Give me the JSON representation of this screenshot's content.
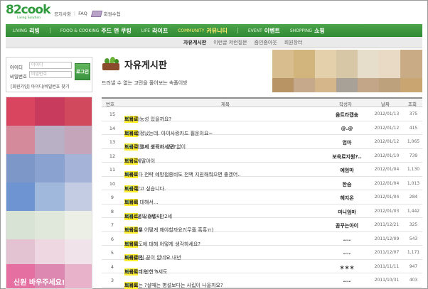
{
  "header": {
    "logo_text": "82cook",
    "logo_sub": "Living Solution",
    "links": [
      "공지사항",
      "FAQ",
      "회원수첩"
    ]
  },
  "nav": {
    "items": [
      {
        "en": "LIVING",
        "ko": "리빙",
        "active": false
      },
      {
        "en": "FOOD & COOKING",
        "ko": "주드 앤 쿠킹",
        "active": false
      },
      {
        "en": "LIFE",
        "ko": "라이프",
        "active": false
      },
      {
        "en": "COMMUNITY",
        "ko": "커뮤니티",
        "active": true
      },
      {
        "en": "EVENT",
        "ko": "이벤트",
        "active": false
      },
      {
        "en": "SHOPPING",
        "ko": "쇼핑",
        "active": false
      }
    ]
  },
  "subnav": {
    "items": [
      "자유게시판",
      "이런글 저런질문",
      "줌인줌아웃",
      "회원장터"
    ]
  },
  "login": {
    "id_label": "아이디",
    "pw_label": "비밀번호",
    "id_placeholder": "아이디",
    "pw_placeholder": "비밀번호",
    "button": "로그인",
    "links": "[회원가입]  아이디/비밀번호 찾기"
  },
  "side_banner": {
    "caption": "신원 바우주세요!"
  },
  "board": {
    "title": "자유게시판",
    "description": "드러낼 수 없는 고민을 풀어보는 속풀이방",
    "columns": [
      "번호",
      "제목",
      "작성자",
      "날짜",
      "조회"
    ],
    "rows": [
      {
        "no": "15",
        "pre": "",
        "hl": "보육료",
        "post": "지원 가능성 있을까요?",
        "cnt": "7",
        "author": "옴트라캡숑",
        "date": "2012/01/13",
        "views": "375"
      },
      {
        "no": "14",
        "pre": "",
        "hl": "보육료",
        "post": " 지원 결정났는데. 아이사랑카드 필운이요~",
        "cnt": "2",
        "author": "@.@",
        "date": "2012/01/12",
        "views": "415"
      },
      {
        "no": "13",
        "pre": "0~2세,5세 소득과 상관 없이 ",
        "hl": "보육료",
        "post": " 지원 어떻게 생각하세요?..",
        "cnt": "15",
        "author": "엄마",
        "date": "2012/01/12",
        "views": "1,065"
      },
      {
        "no": "12",
        "pre": "올해5세딸아이 ",
        "hl": "보육료",
        "post": "지원..",
        "cnt": "7",
        "author": "보육료지원?..",
        "date": "2012/01/10",
        "views": "739"
      },
      {
        "no": "11",
        "pre": "영아 ",
        "hl": "보육료",
        "post": " 지원보다 전략 예방접종비도 전액 지원해줘으면 좋겠어..",
        "cnt": "6",
        "author": "예엄마",
        "date": "2012/01/04",
        "views": "1,130"
      },
      {
        "no": "10",
        "pre": "",
        "hl": "보육료",
        "post": " 지원 받고 싶습니다.",
        "cnt": "13",
        "author": "한숨",
        "date": "2012/01/04",
        "views": "1,013"
      },
      {
        "no": "9",
        "pre": "이사시 ",
        "hl": "보육료",
        "post": "지원에 대해서...",
        "cnt": "5",
        "author": "헤지온",
        "date": "2012/01/04",
        "views": "284"
      },
      {
        "no": "8",
        "pre": "2012년도 0세~만2세 ",
        "hl": "보육료",
        "post": ", 소득에 상관없이 ",
        "hl2": "보육료",
        "post2": " 지원 ..",
        "cnt": "21",
        "author": "미니엄마",
        "date": "2012/01/03",
        "views": "1,442"
      },
      {
        "no": "7",
        "pre": "이런경우 ",
        "hl": "보육료",
        "post": "지원신청 어떻게 해야할까요?(무플 흑흑ㅠ)",
        "cnt": "3",
        "author": "꿈꾸는아이",
        "date": "2011/12/21",
        "views": "325"
      },
      {
        "no": "6",
        "pre": "현 ",
        "hl": "보육료",
        "post": " 지원제도에 대해 어떻게 생각하세요?",
        "cnt": "2",
        "author": "....",
        "date": "2011/12/09",
        "views": "543"
      },
      {
        "no": "5",
        "pre": "부모 육심 끝이 없네요.내년 ",
        "hl": "보육료",
        "post": " 지원관련..",
        "cnt": "6",
        "author": "....",
        "date": "2011/12/07",
        "views": "1,171"
      },
      {
        "no": "4",
        "pre": "내년부터 만현 6세도 ",
        "hl": "보육료",
        "post": " 지원되네요 ^^",
        "cnt": "5",
        "author": "＊＊＊",
        "date": "2011/11/11",
        "views": "947"
      },
      {
        "no": "3",
        "pre": "",
        "hl": "보육료",
        "post": " 지원되는 ?살때는 병설보다는 사립이 나을까요?",
        "cnt": "3",
        "author": "....",
        "date": "2011/10/31",
        "views": "403"
      }
    ]
  }
}
